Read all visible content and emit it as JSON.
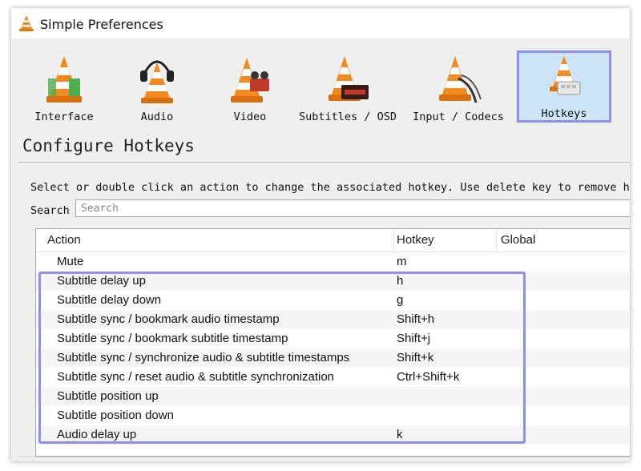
{
  "window": {
    "title": "Simple Preferences"
  },
  "toolbar": {
    "items": [
      {
        "label": "Interface",
        "icon": "interface-cone-icon"
      },
      {
        "label": "Audio",
        "icon": "audio-cone-icon"
      },
      {
        "label": "Video",
        "icon": "video-cone-icon"
      },
      {
        "label": "Subtitles / OSD",
        "icon": "subtitles-cone-icon"
      },
      {
        "label": "Input / Codecs",
        "icon": "input-codecs-cone-icon"
      },
      {
        "label": "Hotkeys",
        "icon": "hotkeys-cone-icon",
        "active": true
      }
    ]
  },
  "section": {
    "title": "Configure Hotkeys"
  },
  "description": "Select or double click an action to change the associated hotkey. Use delete key to remove hotkeys",
  "search": {
    "label": "Search",
    "placeholder": "Search"
  },
  "table": {
    "columns": [
      "Action",
      "Hotkey",
      "Global"
    ],
    "rows": [
      {
        "action": "Mute",
        "hotkey": "m",
        "global": ""
      },
      {
        "action": "Subtitle delay up",
        "hotkey": "h",
        "global": ""
      },
      {
        "action": "Subtitle delay down",
        "hotkey": "g",
        "global": ""
      },
      {
        "action": "Subtitle sync / bookmark audio timestamp",
        "hotkey": "Shift+h",
        "global": ""
      },
      {
        "action": "Subtitle sync / bookmark subtitle timestamp",
        "hotkey": "Shift+j",
        "global": ""
      },
      {
        "action": "Subtitle sync / synchronize audio & subtitle timestamps",
        "hotkey": "Shift+k",
        "global": ""
      },
      {
        "action": "Subtitle sync / reset audio & subtitle synchronization",
        "hotkey": "Ctrl+Shift+k",
        "global": ""
      },
      {
        "action": "Subtitle position up",
        "hotkey": "",
        "global": ""
      },
      {
        "action": "Subtitle position down",
        "hotkey": "",
        "global": ""
      },
      {
        "action": "Audio delay up",
        "hotkey": "k",
        "global": ""
      }
    ]
  },
  "colors": {
    "highlight": "#8a8ff0",
    "active_bg": "#cde6f7",
    "cone_orange": "#f28a1e"
  }
}
